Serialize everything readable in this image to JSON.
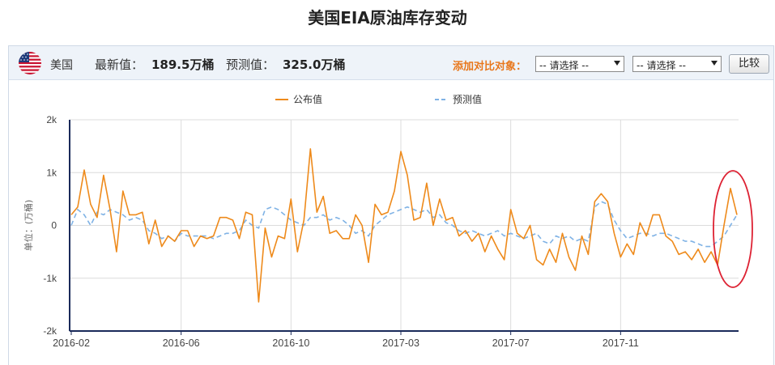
{
  "page": {
    "title": "美国EIA原油库存变动"
  },
  "info_bar": {
    "country": "美国",
    "latest_label": "最新值：",
    "latest_value": "189.5万桶",
    "forecast_label": "预测值：",
    "forecast_value": "325.0万桶",
    "compare_label": "添加对比对象：",
    "select1": "-- 请选择 --",
    "select2": "-- 请选择 --",
    "compare_button": "比较"
  },
  "colors": {
    "published": "#ee8a1b",
    "forecast": "#7fb2e5",
    "highlight": "#dd2233",
    "axis": "#1a2a5a"
  },
  "chart_data": {
    "type": "line",
    "ylabel": "单位：(万桶)",
    "ylim": [
      -2000,
      2000
    ],
    "yticks": [
      -2000,
      -1000,
      0,
      1000,
      2000
    ],
    "ytick_labels": [
      "-2k",
      "-1k",
      "0",
      "1k",
      "2k"
    ],
    "xticks": [
      0,
      17,
      34,
      51,
      68,
      85
    ],
    "xtick_labels": [
      "2016-02",
      "2016-06",
      "2016-10",
      "2017-03",
      "2017-07",
      "2017-11"
    ],
    "grid": true,
    "legend": "top-center",
    "series": [
      {
        "name": "公布值",
        "style": "solid",
        "values": [
          200,
          350,
          1050,
          400,
          150,
          950,
          300,
          -500,
          650,
          200,
          200,
          250,
          -350,
          100,
          -400,
          -200,
          -300,
          -100,
          -100,
          -400,
          -200,
          -250,
          -200,
          150,
          150,
          100,
          -250,
          250,
          200,
          -1450,
          -50,
          -600,
          -200,
          -250,
          500,
          -500,
          100,
          1450,
          250,
          550,
          -150,
          -100,
          -250,
          -250,
          200,
          0,
          -700,
          400,
          200,
          250,
          650,
          1400,
          950,
          100,
          150,
          800,
          0,
          500,
          100,
          150,
          -200,
          -100,
          -300,
          -150,
          -500,
          -200,
          -450,
          -650,
          300,
          -150,
          -250,
          0,
          -650,
          -750,
          -450,
          -700,
          -150,
          -600,
          -850,
          -200,
          -550,
          450,
          600,
          450,
          -150,
          -600,
          -350,
          -550,
          50,
          -200,
          200,
          200,
          -200,
          -300,
          -550,
          -500,
          -650,
          -450,
          -700,
          -500,
          -750,
          0,
          700,
          200
        ]
      },
      {
        "name": "预测值",
        "style": "dashed",
        "values": [
          0,
          300,
          200,
          0,
          250,
          200,
          300,
          250,
          200,
          100,
          150,
          100,
          -100,
          -150,
          -250,
          -200,
          -300,
          -150,
          -200,
          -200,
          -200,
          -200,
          -250,
          -200,
          -150,
          -150,
          -100,
          100,
          0,
          -50,
          300,
          350,
          300,
          200,
          100,
          50,
          0,
          150,
          150,
          200,
          100,
          150,
          100,
          0,
          -150,
          -100,
          -200,
          0,
          100,
          200,
          250,
          300,
          350,
          300,
          250,
          300,
          150,
          200,
          50,
          0,
          -100,
          -150,
          -100,
          -150,
          -200,
          -150,
          -100,
          -200,
          -150,
          -200,
          -250,
          -200,
          -150,
          -300,
          -350,
          -200,
          -250,
          -200,
          -300,
          -250,
          -300,
          350,
          450,
          400,
          100,
          -100,
          -250,
          -200,
          -150,
          -150,
          -200,
          -150,
          -150,
          -200,
          -250,
          -300,
          -300,
          -350,
          -400,
          -400,
          -300,
          -200,
          0,
          200
        ]
      }
    ]
  }
}
